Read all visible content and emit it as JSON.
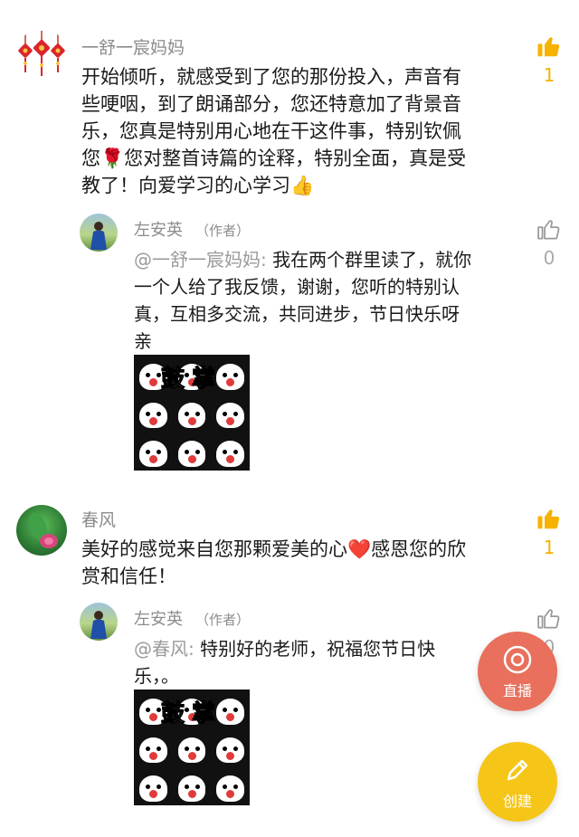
{
  "colors": {
    "like_active": "#f5b300",
    "live_button": "#e8705c",
    "create_button": "#f5c518"
  },
  "comments": [
    {
      "username": "一舒一宸妈妈",
      "text_lines": [
        "开始倾听，就感受到了您的那份投入，声音有",
        "些哽咽，到了朗诵部分，您还特意加了背景音",
        "乐，您真是特别用心地在干这件事，特别钦佩",
        "您🌹您对整首诗篇的诠释，特别全面，真是受",
        "教了！向爱学习的心学习👍"
      ],
      "like_count": "1",
      "reply": {
        "username": "左安英",
        "tag": "（作者）",
        "mention": "@一舒一宸妈妈: ",
        "text_lines": [
          "我在两个群里读了，就你",
          "一个人给了我反馈，谢谢，您听的特别认",
          "真，互相多交流，共同进步，节日快乐呀",
          "亲"
        ],
        "sticker_caption": "鼓掌",
        "like_count": "0"
      }
    },
    {
      "username": "春风",
      "text_lines": [
        "美好的感觉来自您那颗爱美的心❤️感恩您的欣",
        "赏和信任！"
      ],
      "like_count": "1",
      "reply": {
        "username": "左安英",
        "tag": "（作者）",
        "mention": "@春风: ",
        "text_lines": [
          "特别好的老师，祝福您节日快",
          "乐，。"
        ],
        "sticker_caption": "鼓掌",
        "like_count": "0"
      }
    }
  ],
  "fab": {
    "live_label": "直播",
    "create_label": "创建"
  }
}
